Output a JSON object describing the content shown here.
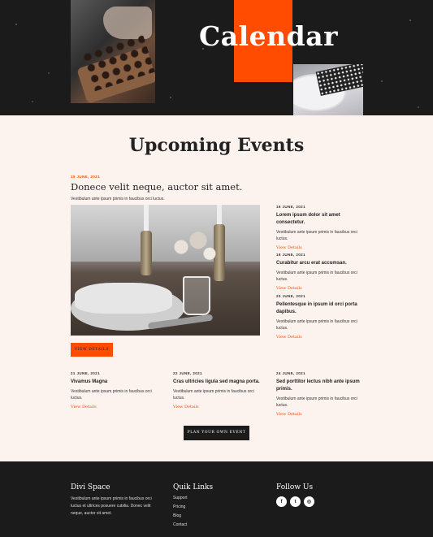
{
  "hero": {
    "title": "Calendar"
  },
  "events_section": {
    "title": "Upcoming Events"
  },
  "featured": {
    "date": "15 JUNE, 2021",
    "title": "Donece velit neque, auctor sit amet.",
    "subtitle": "Vestibulum ante ipsum primis in faucibus orci luctus.",
    "button_label": "VIEW DETAILS"
  },
  "side_events": [
    {
      "date": "16 JUNE, 2021",
      "title": "Lorem ipsum dolor sit amet consectetur.",
      "desc": "Vestibulum ante ipsum primis in faucibus orci luctus.",
      "link": "View Details"
    },
    {
      "date": "18 JUNE, 2021",
      "title": "Curabitur arcu erat accumsan.",
      "desc": "Vestibulum ante ipsum primis in faucibus orci luctus.",
      "link": "View Details"
    },
    {
      "date": "20 JUNE, 2021",
      "title": "Pellentesque in ipsum id orci porta dapibus.",
      "desc": "Vestibulum ante ipsum primis in faucibus orci luctus.",
      "link": "View Details"
    }
  ],
  "bottom_events": [
    {
      "date": "21 JUNE, 2021",
      "title": "Vivamus Magna",
      "desc": "Vestibulum ante ipsum primis in faucibus orci luctus.",
      "link": "View Details"
    },
    {
      "date": "22 JUNE, 2021",
      "title": "Cras ultricies ligula sed magna porta.",
      "desc": "Vestibulum ante ipsum primis in faucibus orci luctus.",
      "link": "View Details"
    },
    {
      "date": "24 JUNE, 2021",
      "title": "Sed porttitor lectus nibh ante ipsum primis.",
      "desc": "Vestibulum ante ipsum primis in faucibus orci luctus.",
      "link": "View Details"
    }
  ],
  "plan_button": {
    "label": "PLAN YOUR OWN EVENT"
  },
  "footer": {
    "about": {
      "heading": "Divi Space",
      "text": "Vestibulum ante ipsum primis in faucibus orci luctus et ultrices posuere cubilia. Donec velit neque, auctor sit amet."
    },
    "links": {
      "heading": "Quik Links",
      "items": [
        "Support",
        "Pricing",
        "Blog",
        "Contact"
      ]
    },
    "follow": {
      "heading": "Follow Us",
      "icons": [
        {
          "name": "facebook-icon",
          "glyph": "f"
        },
        {
          "name": "twitter-icon",
          "glyph": "t"
        },
        {
          "name": "instagram-icon",
          "glyph": "◎"
        }
      ]
    }
  },
  "colors": {
    "accent": "#ff4c00",
    "dark": "#1b1b1b",
    "background": "#fcf3ef"
  }
}
